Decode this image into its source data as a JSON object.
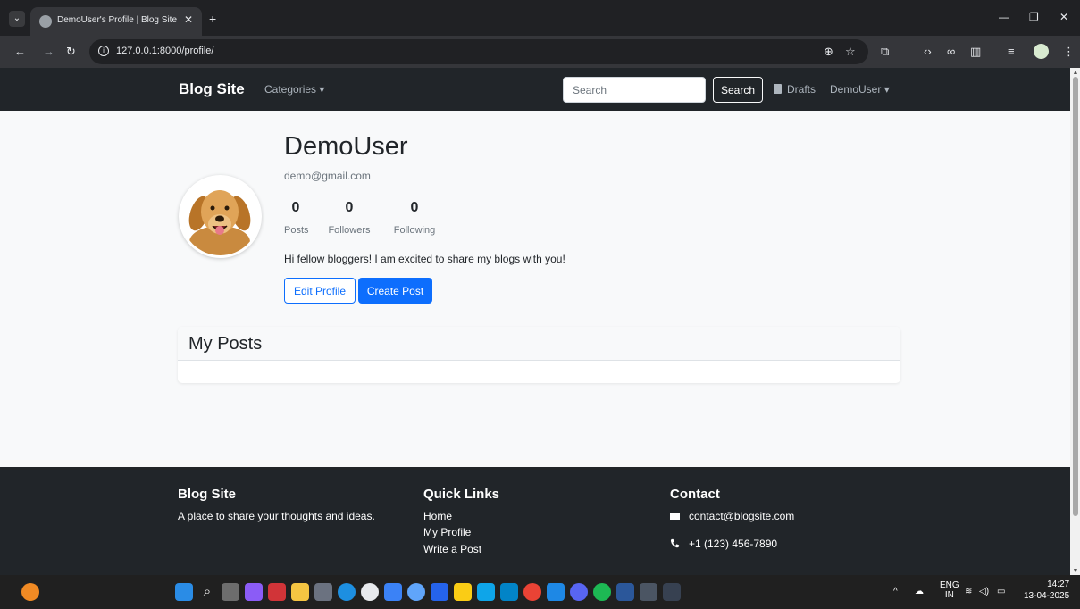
{
  "browser": {
    "tab_title": "DemoUser's Profile | Blog Site",
    "url": "127.0.0.1:8000/profile/"
  },
  "navbar": {
    "brand": "Blog Site",
    "categories": "Categories",
    "search_placeholder": "Search",
    "search_button": "Search",
    "drafts": "Drafts",
    "user": "DemoUser"
  },
  "profile": {
    "username": "DemoUser",
    "email": "demo@gmail.com",
    "stats": [
      {
        "value": "0",
        "label": "Posts"
      },
      {
        "value": "0",
        "label": "Followers"
      },
      {
        "value": "0",
        "label": "Following"
      }
    ],
    "bio": "Hi fellow bloggers! I am excited to share my blogs with you!",
    "edit_button": "Edit Profile",
    "create_button": "Create Post"
  },
  "posts_card": {
    "title": "My Posts"
  },
  "footer": {
    "about_title": "Blog Site",
    "about_text": "A place to share your thoughts and ideas.",
    "links_title": "Quick Links",
    "links": [
      "Home",
      "My Profile",
      "Write a Post"
    ],
    "contact_title": "Contact",
    "email": "contact@blogsite.com",
    "phone": "+1 (123) 456-7890"
  },
  "taskbar": {
    "language": "ENG",
    "region": "IN",
    "time": "14:27",
    "date": "13-04-2025"
  },
  "colors": {
    "primary": "#0d6efd",
    "navbar_bg": "#212529"
  }
}
